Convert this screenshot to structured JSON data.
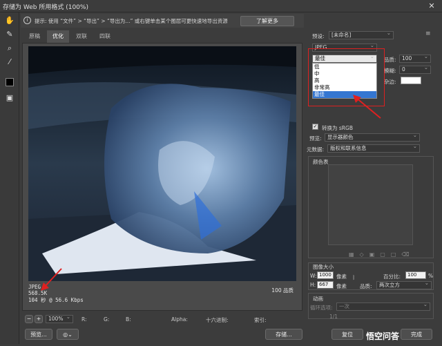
{
  "window": {
    "title": "存储为 Web 所用格式 (100%)",
    "close": "✕"
  },
  "hint": {
    "text": "提示: 使用 “文件” > “导出” > “导出为...” 或右键单击某个图层可更快速地导出资源",
    "learn_more": "了解更多"
  },
  "tabs": [
    "原稿",
    "优化",
    "双联",
    "四联"
  ],
  "image_info": {
    "format": "JPEG",
    "size": "568.5K",
    "time": "104 秒 @ 56.6 Kbps",
    "quality_pct": "100 品质"
  },
  "status": {
    "zoom": "100%",
    "r": "R:",
    "g": "G:",
    "b": "B:",
    "alpha": "Alpha:",
    "hex": "十六进制:",
    "index": "索引:"
  },
  "bottom": {
    "preview": "预览...",
    "save": "存储...",
    "reset": "复位",
    "done": "完成"
  },
  "panel": {
    "preset_label": "预设:",
    "preset_value": "[未命名]",
    "format_value": "JPEG",
    "quality_select": "最佳",
    "quality_label": "品质:",
    "quality_value": "100",
    "blur_label": "模糊:",
    "blur_value": "0",
    "matte_label": "杂边:",
    "dropdown_options": [
      "低",
      "中",
      "高",
      "非常高",
      "最佳"
    ],
    "convert_srgb": "转换为 sRGB",
    "preview_label": "预览:",
    "preview_value": "显示器颜色",
    "metadata_label": "元数据:",
    "metadata_value": "版权和联系信息",
    "color_table": "颜色表",
    "image_size": "图像大小",
    "w_label": "W:",
    "w_value": "1000",
    "h_label": "H:",
    "h_value": "667",
    "unit": "像素",
    "percent_label": "百分比:",
    "percent_value": "100",
    "percent_sign": "%",
    "size_quality_label": "品质:",
    "size_quality_value": "两次立方",
    "animation": "动画",
    "loop_label": "循环选项:",
    "loop_value": "一次",
    "frame": "1/1"
  },
  "watermark": "悟空问答"
}
